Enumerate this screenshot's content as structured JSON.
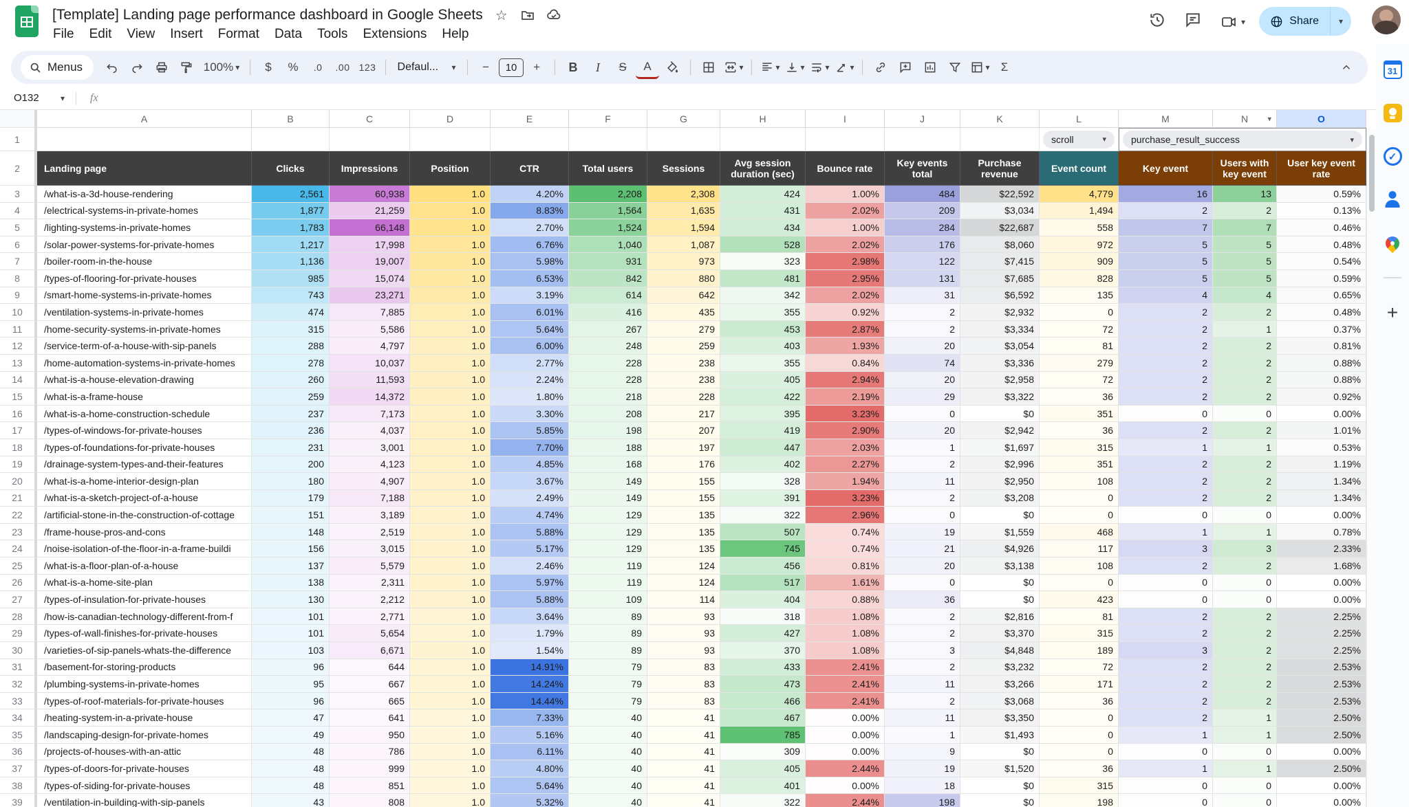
{
  "titlebar": {
    "title": "[Template] Landing page performance dashboard in Google Sheets"
  },
  "menubar": [
    "File",
    "Edit",
    "View",
    "Insert",
    "Format",
    "Data",
    "Tools",
    "Extensions",
    "Help"
  ],
  "topbar_right": {
    "share_label": "Share"
  },
  "toolbar": {
    "menus_label": "Menus",
    "zoom": "100%",
    "currency": "$",
    "percent": "%",
    "decrease_decimal": ".0",
    "increase_decimal": ".00",
    "more_formats": "123",
    "font": "Defaul...",
    "font_size": "10",
    "minus": "−",
    "plus": "+",
    "bold": "B",
    "italic": "I",
    "strikethrough": "S",
    "text_color": "A",
    "functions": "Σ"
  },
  "formula_bar": {
    "name_box": "O132",
    "fx": "fx"
  },
  "grid": {
    "col_letters": [
      "A",
      "B",
      "C",
      "D",
      "E",
      "F",
      "G",
      "H",
      "I",
      "J",
      "K",
      "L",
      "M",
      "N",
      "O"
    ],
    "selected_col": "O",
    "dropdown_col": "N",
    "row_start": 3,
    "row1": {
      "scroll_chip": "scroll",
      "event_chip": "purchase_result_success"
    },
    "headers": [
      {
        "label": "Landing page",
        "bg": "#3f3f3f"
      },
      {
        "label": "Clicks",
        "bg": "#3f3f3f"
      },
      {
        "label": "Impressions",
        "bg": "#3f3f3f"
      },
      {
        "label": "Position",
        "bg": "#3f3f3f"
      },
      {
        "label": "CTR",
        "bg": "#3f3f3f"
      },
      {
        "label": "Total users",
        "bg": "#3f3f3f"
      },
      {
        "label": "Sessions",
        "bg": "#3f3f3f"
      },
      {
        "label": "Avg session duration (sec)",
        "bg": "#3f3f3f"
      },
      {
        "label": "Bounce rate",
        "bg": "#3f3f3f"
      },
      {
        "label": "Key events total",
        "bg": "#3f3f3f"
      },
      {
        "label": "Purchase revenue",
        "bg": "#3f3f3f"
      },
      {
        "label": "Event count",
        "bg": "#2a6b76"
      },
      {
        "label": "Key event",
        "bg": "#7a3e06"
      },
      {
        "label": "Users with key event",
        "bg": "#7a3e06"
      },
      {
        "label": "User key event rate",
        "bg": "#7a3e06"
      }
    ],
    "scales": {
      "1": {
        "min": 0,
        "max": 2561,
        "lo": "#f2fafd",
        "hi": "#47b8e8",
        "pow": 1
      },
      "2": {
        "min": 0,
        "max": 66148,
        "lo": "#fdf8fd",
        "hi": "#c470d2",
        "pow": 1
      },
      "3": {
        "proxy": 1,
        "min": 0,
        "max": 2561,
        "lo": "#fffefb",
        "hi": "#ffdf7e",
        "pow": 0.35
      },
      "4": {
        "min": 0,
        "max": 14.91,
        "lo": "#f4f7fe",
        "hi": "#3b74e0",
        "pow": 1
      },
      "5": {
        "min": 0,
        "max": 2208,
        "lo": "#f6fcf7",
        "hi": "#5cbf71",
        "pow": 1
      },
      "6": {
        "min": 0,
        "max": 2308,
        "lo": "#fffef7",
        "hi": "#ffe28a",
        "pow": 1
      },
      "7": {
        "min": 300,
        "max": 785,
        "lo": "#fdfefd",
        "hi": "#5fc173",
        "pow": 1
      },
      "8": {
        "min": 0,
        "max": 3.23,
        "lo": "#fffdfd",
        "hi": "#e36c6a",
        "pow": 1
      },
      "9": {
        "min": 0,
        "max": 484,
        "lo": "#fbfbfe",
        "hi": "#9aa0dc",
        "pow": 0.7
      },
      "10": {
        "min": 0,
        "max": 22687,
        "lo": "#ffffff",
        "hi": "#d5d7d9",
        "pow": 0.6
      },
      "11": {
        "min": 0,
        "max": 4779,
        "lo": "#fffdf6",
        "hi": "#ffe189",
        "pow": 1
      },
      "12": {
        "min": 0,
        "max": 16,
        "lo": "#fdfdfe",
        "hi": "#a3aae1",
        "pow": 0.5
      },
      "13": {
        "min": 0,
        "max": 13,
        "lo": "#fbfdfb",
        "hi": "#8ed099",
        "pow": 0.6
      },
      "14": {
        "min": 0,
        "max": 2.53,
        "lo": "#ffffff",
        "hi": "#d9dadc",
        "pow": 1.4
      }
    },
    "rows": [
      [
        "/what-is-a-3d-house-rendering",
        "2,561",
        "60,938",
        "1.0",
        "4.20%",
        "2,208",
        "2,308",
        "424",
        "1.00%",
        "484",
        "$22,592",
        "4,779",
        "16",
        "13",
        "0.59%"
      ],
      [
        "/electrical-systems-in-private-homes",
        "1,877",
        "21,259",
        "1.0",
        "8.83%",
        "1,564",
        "1,635",
        "431",
        "2.02%",
        "209",
        "$3,034",
        "1,494",
        "2",
        "2",
        "0.13%"
      ],
      [
        "/lighting-systems-in-private-homes",
        "1,783",
        "66,148",
        "1.0",
        "2.70%",
        "1,524",
        "1,594",
        "434",
        "1.00%",
        "284",
        "$22,687",
        "558",
        "7",
        "7",
        "0.46%"
      ],
      [
        "/solar-power-systems-for-private-homes",
        "1,217",
        "17,998",
        "1.0",
        "6.76%",
        "1,040",
        "1,087",
        "528",
        "2.02%",
        "176",
        "$8,060",
        "972",
        "5",
        "5",
        "0.48%"
      ],
      [
        "/boiler-room-in-the-house",
        "1,136",
        "19,007",
        "1.0",
        "5.98%",
        "931",
        "973",
        "323",
        "2.98%",
        "122",
        "$7,415",
        "909",
        "5",
        "5",
        "0.54%"
      ],
      [
        "/types-of-flooring-for-private-houses",
        "985",
        "15,074",
        "1.0",
        "6.53%",
        "842",
        "880",
        "481",
        "2.95%",
        "131",
        "$7,685",
        "828",
        "5",
        "5",
        "0.59%"
      ],
      [
        "/smart-home-systems-in-private-homes",
        "743",
        "23,271",
        "1.0",
        "3.19%",
        "614",
        "642",
        "342",
        "2.02%",
        "31",
        "$6,592",
        "135",
        "4",
        "4",
        "0.65%"
      ],
      [
        "/ventilation-systems-in-private-homes",
        "474",
        "7,885",
        "1.0",
        "6.01%",
        "416",
        "435",
        "355",
        "0.92%",
        "2",
        "$2,932",
        "0",
        "2",
        "2",
        "0.48%"
      ],
      [
        "/home-security-systems-in-private-homes",
        "315",
        "5,586",
        "1.0",
        "5.64%",
        "267",
        "279",
        "453",
        "2.87%",
        "2",
        "$3,334",
        "72",
        "2",
        "1",
        "0.37%"
      ],
      [
        "/service-term-of-a-house-with-sip-panels",
        "288",
        "4,797",
        "1.0",
        "6.00%",
        "248",
        "259",
        "403",
        "1.93%",
        "20",
        "$3,054",
        "81",
        "2",
        "2",
        "0.81%"
      ],
      [
        "/home-automation-systems-in-private-homes",
        "278",
        "10,037",
        "1.0",
        "2.77%",
        "228",
        "238",
        "355",
        "0.84%",
        "74",
        "$3,336",
        "279",
        "2",
        "2",
        "0.88%"
      ],
      [
        "/what-is-a-house-elevation-drawing",
        "260",
        "11,593",
        "1.0",
        "2.24%",
        "228",
        "238",
        "405",
        "2.94%",
        "20",
        "$2,958",
        "72",
        "2",
        "2",
        "0.88%"
      ],
      [
        "/what-is-a-frame-house",
        "259",
        "14,372",
        "1.0",
        "1.80%",
        "218",
        "228",
        "422",
        "2.19%",
        "29",
        "$3,322",
        "36",
        "2",
        "2",
        "0.92%"
      ],
      [
        "/what-is-a-home-construction-schedule",
        "237",
        "7,173",
        "1.0",
        "3.30%",
        "208",
        "217",
        "395",
        "3.23%",
        "0",
        "$0",
        "351",
        "0",
        "0",
        "0.00%"
      ],
      [
        "/types-of-windows-for-private-houses",
        "236",
        "4,037",
        "1.0",
        "5.85%",
        "198",
        "207",
        "419",
        "2.90%",
        "20",
        "$2,942",
        "36",
        "2",
        "2",
        "1.01%"
      ],
      [
        "/types-of-foundations-for-private-houses",
        "231",
        "3,001",
        "1.0",
        "7.70%",
        "188",
        "197",
        "447",
        "2.03%",
        "1",
        "$1,697",
        "315",
        "1",
        "1",
        "0.53%"
      ],
      [
        "/drainage-system-types-and-their-features",
        "200",
        "4,123",
        "1.0",
        "4.85%",
        "168",
        "176",
        "402",
        "2.27%",
        "2",
        "$2,996",
        "351",
        "2",
        "2",
        "1.19%"
      ],
      [
        "/what-is-a-home-interior-design-plan",
        "180",
        "4,907",
        "1.0",
        "3.67%",
        "149",
        "155",
        "328",
        "1.94%",
        "11",
        "$2,950",
        "108",
        "2",
        "2",
        "1.34%"
      ],
      [
        "/what-is-a-sketch-project-of-a-house",
        "179",
        "7,188",
        "1.0",
        "2.49%",
        "149",
        "155",
        "391",
        "3.23%",
        "2",
        "$3,208",
        "0",
        "2",
        "2",
        "1.34%"
      ],
      [
        "/artificial-stone-in-the-construction-of-cottage",
        "151",
        "3,189",
        "1.0",
        "4.74%",
        "129",
        "135",
        "322",
        "2.96%",
        "0",
        "$0",
        "0",
        "0",
        "0",
        "0.00%"
      ],
      [
        "/frame-house-pros-and-cons",
        "148",
        "2,519",
        "1.0",
        "5.88%",
        "129",
        "135",
        "507",
        "0.74%",
        "19",
        "$1,559",
        "468",
        "1",
        "1",
        "0.78%"
      ],
      [
        "/noise-isolation-of-the-floor-in-a-frame-buildi",
        "156",
        "3,015",
        "1.0",
        "5.17%",
        "129",
        "135",
        "745",
        "0.74%",
        "21",
        "$4,926",
        "117",
        "3",
        "3",
        "2.33%"
      ],
      [
        "/what-is-a-floor-plan-of-a-house",
        "137",
        "5,579",
        "1.0",
        "2.46%",
        "119",
        "124",
        "456",
        "0.81%",
        "20",
        "$3,138",
        "108",
        "2",
        "2",
        "1.68%"
      ],
      [
        "/what-is-a-home-site-plan",
        "138",
        "2,311",
        "1.0",
        "5.97%",
        "119",
        "124",
        "517",
        "1.61%",
        "0",
        "$0",
        "0",
        "0",
        "0",
        "0.00%"
      ],
      [
        "/types-of-insulation-for-private-houses",
        "130",
        "2,212",
        "1.0",
        "5.88%",
        "109",
        "114",
        "404",
        "0.88%",
        "36",
        "$0",
        "423",
        "0",
        "0",
        "0.00%"
      ],
      [
        "/how-is-canadian-technology-different-from-f",
        "101",
        "2,771",
        "1.0",
        "3.64%",
        "89",
        "93",
        "318",
        "1.08%",
        "2",
        "$2,816",
        "81",
        "2",
        "2",
        "2.25%"
      ],
      [
        "/types-of-wall-finishes-for-private-houses",
        "101",
        "5,654",
        "1.0",
        "1.79%",
        "89",
        "93",
        "427",
        "1.08%",
        "2",
        "$3,370",
        "315",
        "2",
        "2",
        "2.25%"
      ],
      [
        "/varieties-of-sip-panels-whats-the-difference",
        "103",
        "6,671",
        "1.0",
        "1.54%",
        "89",
        "93",
        "370",
        "1.08%",
        "3",
        "$4,848",
        "189",
        "3",
        "2",
        "2.25%"
      ],
      [
        "/basement-for-storing-products",
        "96",
        "644",
        "1.0",
        "14.91%",
        "79",
        "83",
        "433",
        "2.41%",
        "2",
        "$3,232",
        "72",
        "2",
        "2",
        "2.53%"
      ],
      [
        "/plumbing-systems-in-private-homes",
        "95",
        "667",
        "1.0",
        "14.24%",
        "79",
        "83",
        "473",
        "2.41%",
        "11",
        "$3,266",
        "171",
        "2",
        "2",
        "2.53%"
      ],
      [
        "/types-of-roof-materials-for-private-houses",
        "96",
        "665",
        "1.0",
        "14.44%",
        "79",
        "83",
        "466",
        "2.41%",
        "2",
        "$3,068",
        "36",
        "2",
        "2",
        "2.53%"
      ],
      [
        "/heating-system-in-a-private-house",
        "47",
        "641",
        "1.0",
        "7.33%",
        "40",
        "41",
        "467",
        "0.00%",
        "11",
        "$3,350",
        "0",
        "2",
        "1",
        "2.50%"
      ],
      [
        "/landscaping-design-for-private-homes",
        "49",
        "950",
        "1.0",
        "5.16%",
        "40",
        "41",
        "785",
        "0.00%",
        "1",
        "$1,493",
        "0",
        "1",
        "1",
        "2.50%"
      ],
      [
        "/projects-of-houses-with-an-attic",
        "48",
        "786",
        "1.0",
        "6.11%",
        "40",
        "41",
        "309",
        "0.00%",
        "9",
        "$0",
        "0",
        "0",
        "0",
        "0.00%"
      ],
      [
        "/types-of-doors-for-private-houses",
        "48",
        "999",
        "1.0",
        "4.80%",
        "40",
        "41",
        "405",
        "2.44%",
        "19",
        "$1,520",
        "36",
        "1",
        "1",
        "2.50%"
      ],
      [
        "/types-of-siding-for-private-houses",
        "48",
        "851",
        "1.0",
        "5.64%",
        "40",
        "41",
        "401",
        "0.00%",
        "18",
        "$0",
        "315",
        "0",
        "0",
        "0.00%"
      ],
      [
        "/ventilation-in-building-with-sip-panels",
        "43",
        "808",
        "1.0",
        "5.32%",
        "40",
        "41",
        "322",
        "2.44%",
        "198",
        "$0",
        "198",
        "0",
        "0",
        "0.00%"
      ]
    ]
  },
  "side_panel": {
    "calendar_label": "31"
  }
}
